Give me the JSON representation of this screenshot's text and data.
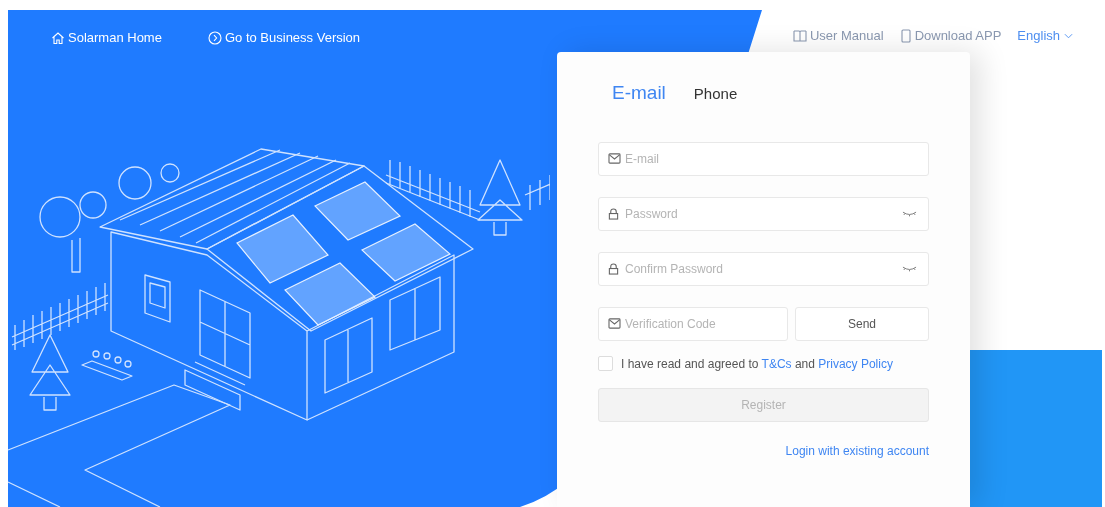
{
  "header": {
    "home_link": "Solarman Home",
    "business_link": "Go to Business Version",
    "user_manual_link": "User Manual",
    "download_link": "Download APP",
    "language": "English"
  },
  "tabs": [
    {
      "label": "E-mail",
      "selected": true
    },
    {
      "label": "Phone",
      "selected": false
    }
  ],
  "fields": [
    {
      "kind": "email",
      "placeholder": "E-mail"
    },
    {
      "kind": "password",
      "placeholder": "Password"
    },
    {
      "kind": "password",
      "placeholder": "Confirm Password"
    }
  ],
  "verification": {
    "placeholder": "Verification Code",
    "button": "Send"
  },
  "agreement": {
    "checked": false,
    "text": "I have read and agreed to",
    "terms_link": "T&Cs",
    "conjunction": "and",
    "privacy_link": "Privacy Policy"
  },
  "register_button": {
    "label": "Register",
    "disabled": true
  },
  "login_link": "Login with existing account"
}
